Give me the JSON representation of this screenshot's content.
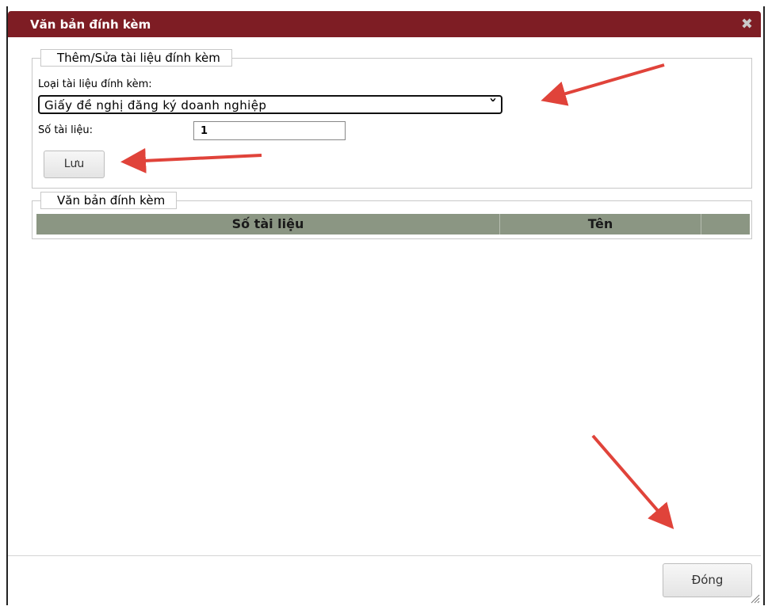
{
  "dialog": {
    "title": "Văn bản đính kèm",
    "close_icon": "close-icon",
    "title_bar_color": "#7e1d24"
  },
  "add_section": {
    "legend": "Thêm/Sửa tài liệu đính kèm",
    "doc_type_label": "Loại tài liệu đính kèm:",
    "doc_type_value": "Giấy đề nghị đăng ký doanh nghiệp",
    "doc_number_label": "Số tài liệu:",
    "doc_number_value": "1",
    "save_label": "Lưu"
  },
  "attached_section": {
    "legend": "Văn bản đính kèm",
    "columns": [
      "Số tài liệu",
      "Tên",
      ""
    ],
    "rows": []
  },
  "footer": {
    "close_label": "Đóng"
  },
  "annotation_arrow_color": "#e0433a"
}
